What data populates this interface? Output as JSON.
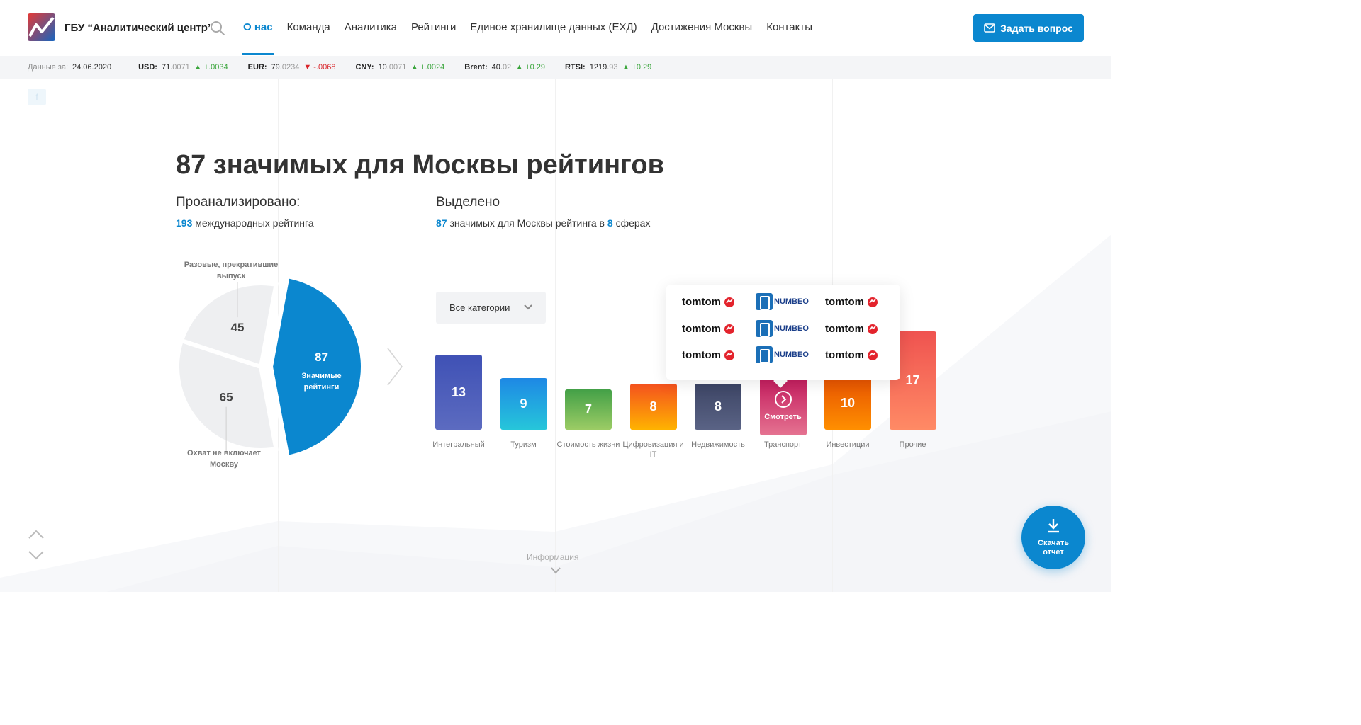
{
  "header": {
    "org_name": "ГБУ “Аналитический центр”",
    "nav": [
      "О нас",
      "Команда",
      "Аналитика",
      "Рейтинги",
      "Единое хранилище данных (ЕХД)",
      "Достижения Москвы",
      "Контакты"
    ],
    "ask_button": "Задать вопрос"
  },
  "ticker": {
    "date_label": "Данные за:",
    "date": "24.06.2020",
    "items": [
      {
        "name": "USD:",
        "main": "71.",
        "dec": "0071",
        "change": "+.0034",
        "dir": "up",
        "gap": ""
      },
      {
        "name": "EUR:",
        "main": "79.",
        "dec": "0234",
        "change": "-.0068",
        "dir": "down",
        "gap": " "
      },
      {
        "name": "CNY:",
        "main": "10.",
        "dec": "0071",
        "change": "+.0024",
        "dir": "up",
        "gap": " "
      },
      {
        "name": "Brent:",
        "main": "40.",
        "dec": "02",
        "change": "+0.29",
        "dir": "up",
        "gap": " "
      },
      {
        "name": "RTSI:",
        "main": "1219.",
        "dec": "93",
        "change": "+0.29",
        "dir": "up",
        "gap": " "
      }
    ]
  },
  "main": {
    "title": "87 значимых для Москвы рейтингов",
    "analyzed": {
      "heading": "Проанализировано:",
      "count": "193",
      "text": "международных рейтинга"
    },
    "selected": {
      "heading": "Выделено",
      "count": "87",
      "text_a": "значимых для Москвы рейтинга в",
      "spheres": "8",
      "text_b": "сферах"
    },
    "pie": {
      "label_top": "Разовые, прекратившие выпуск",
      "label_bottom": "Охват не включает Москву",
      "main_label": "Значимые рейтинги",
      "colors": {
        "main": "#0b87cf",
        "rest": "#eeeff1"
      }
    },
    "dropdown": "Все категории",
    "bars": [
      {
        "value": "13",
        "label": "Интегральный",
        "from": "#3f51b5",
        "to": "#5c6bc0"
      },
      {
        "value": "9",
        "label": "Туризм",
        "from": "#1e88e5",
        "to": "#26c6da"
      },
      {
        "value": "7",
        "label": "Стоимость жизни",
        "from": "#43a047",
        "to": "#9ccc65"
      },
      {
        "value": "8",
        "label": "Цифровизация и IT",
        "from": "#f4511e",
        "to": "#ffb300"
      },
      {
        "value": "8",
        "label": "Недвижимость",
        "from": "#3d4565",
        "to": "#5a6385"
      },
      {
        "value": "",
        "label": "Транспорт",
        "from": "#c2185b",
        "to": "#e57391",
        "action": "Смотреть"
      },
      {
        "value": "10",
        "label": "Инвестиции",
        "from": "#e65100",
        "to": "#ff8f00"
      },
      {
        "value": "17",
        "label": "Прочие",
        "from": "#ef5350",
        "to": "#ff8a65"
      }
    ],
    "popup_logos": [
      "tomtom",
      "NUMBEO",
      "tomtom",
      "tomtom",
      "NUMBEO",
      "tomtom",
      "tomtom",
      "NUMBEO",
      "tomtom"
    ],
    "info_link": "Информация",
    "download": "Скачать отчет"
  },
  "chart_data": {
    "type": "pie",
    "categories": [
      "Значимые рейтинги",
      "Разовые, прекратившие выпуск",
      "Охват не включает Москву"
    ],
    "values": [
      87,
      45,
      65
    ]
  }
}
